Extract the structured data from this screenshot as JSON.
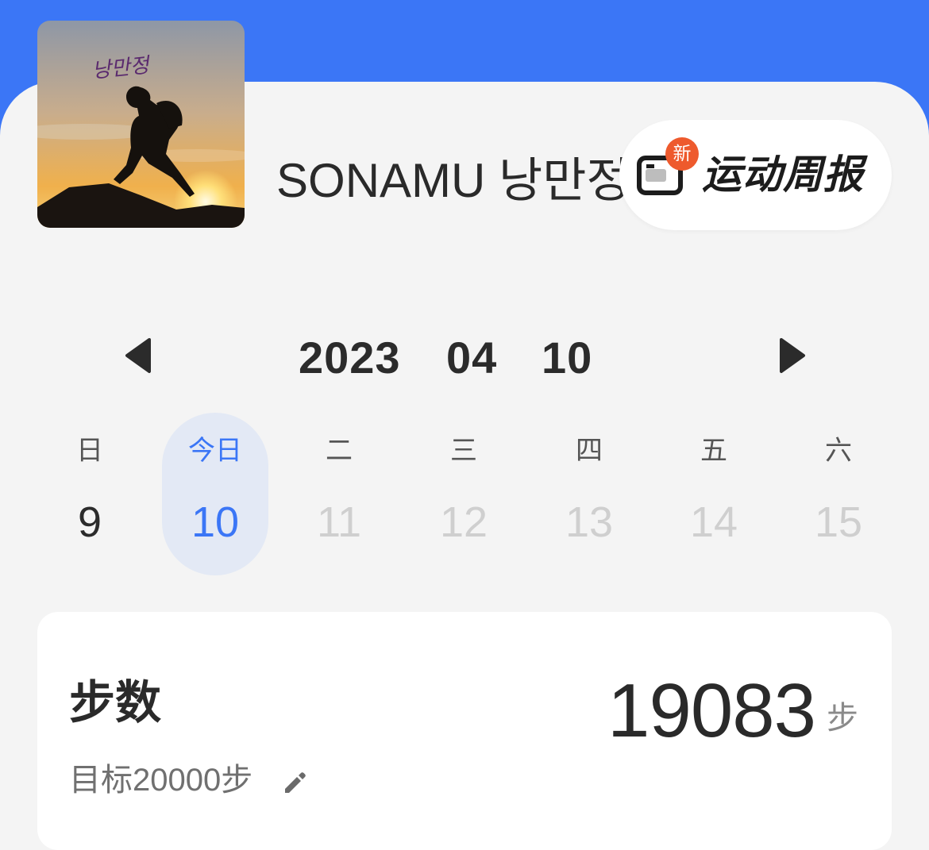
{
  "profile": {
    "username": "SONAMU 낭만정",
    "avatar_art_text": "낭만정"
  },
  "report_button": {
    "badge": "新",
    "label": "运动周报",
    "icon": "report-icon"
  },
  "date_nav": {
    "year": "2023",
    "month": "04",
    "day": "10",
    "prev_icon": "triangle-left-icon",
    "next_icon": "triangle-right-icon"
  },
  "week": [
    {
      "name": "日",
      "num": "9"
    },
    {
      "name": "今日",
      "num": "10"
    },
    {
      "name": "二",
      "num": "11"
    },
    {
      "name": "三",
      "num": "12"
    },
    {
      "name": "四",
      "num": "13"
    },
    {
      "name": "五",
      "num": "14"
    },
    {
      "name": "六",
      "num": "15"
    }
  ],
  "steps_card": {
    "title": "步数",
    "goal": "目标20000步",
    "value": "19083",
    "unit": "步",
    "edit_icon": "pencil-icon"
  },
  "colors": {
    "accent": "#3b76f6",
    "badge": "#ee5a2d",
    "selected_bg": "#e3e9f5"
  }
}
